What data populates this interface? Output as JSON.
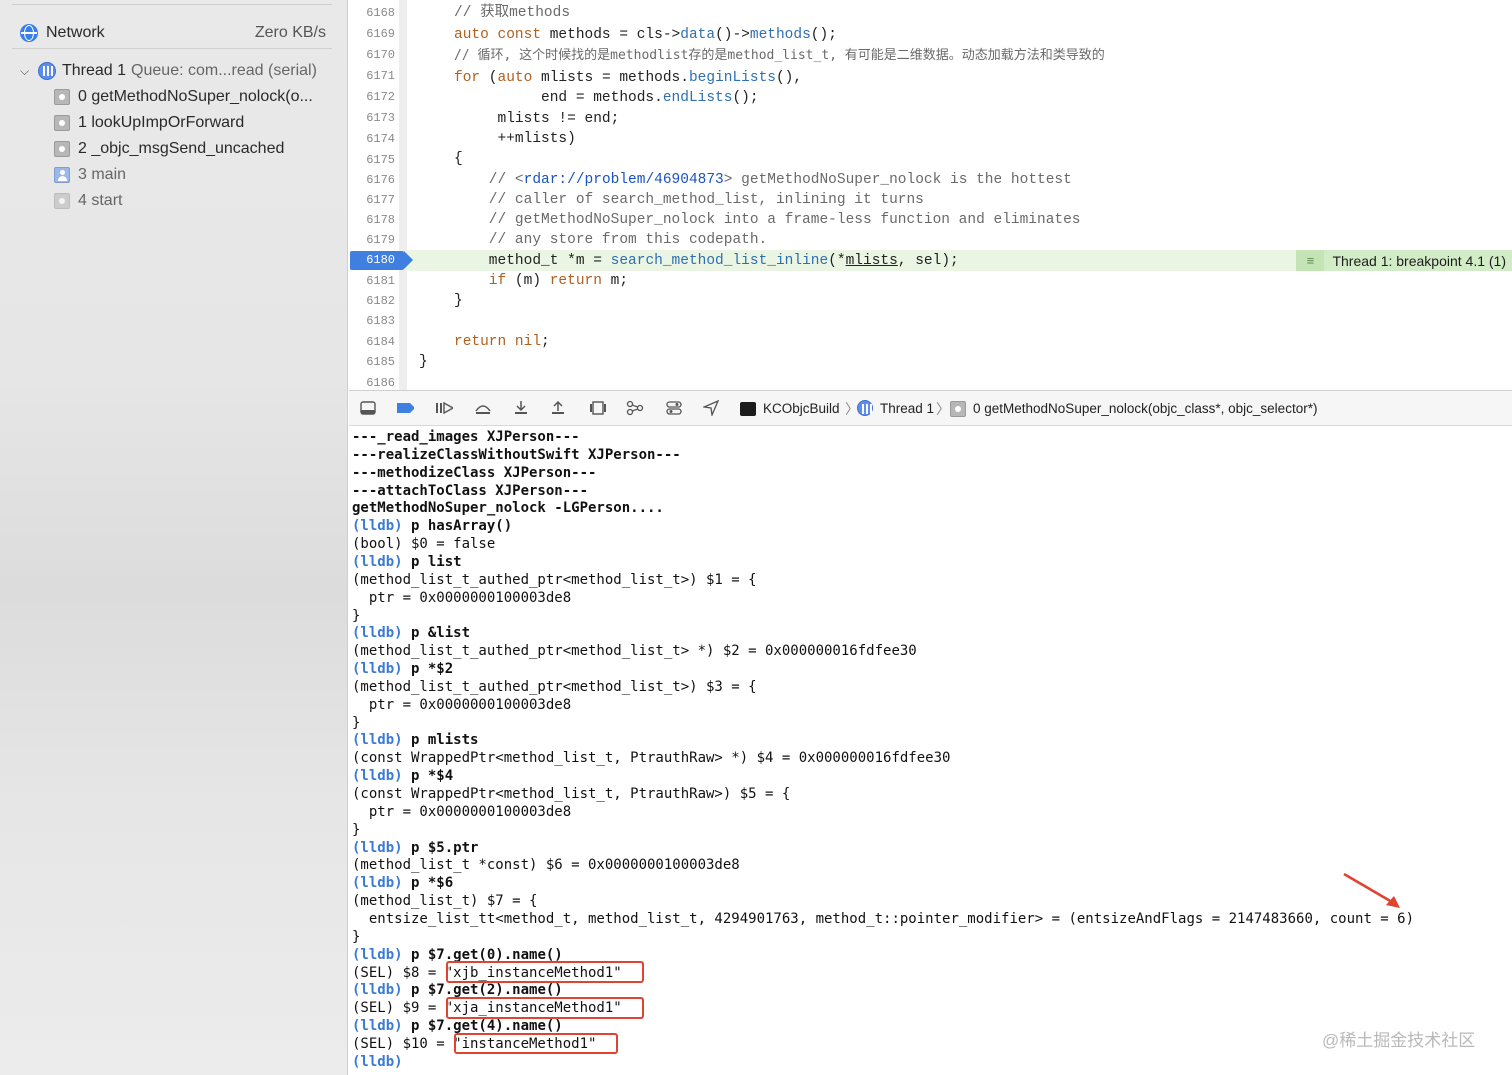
{
  "sidebar": {
    "network": {
      "label": "Network",
      "value": "Zero KB/s"
    },
    "thread": {
      "name": "Thread 1",
      "queue": "Queue: com...read (serial)"
    },
    "frames": [
      {
        "label": "0 getMethodNoSuper_nolock(o..."
      },
      {
        "label": "1 lookUpImpOrForward"
      },
      {
        "label": "2 _objc_msgSend_uncached"
      },
      {
        "label": "3 main"
      },
      {
        "label": "4 start"
      }
    ]
  },
  "editor": {
    "line_numbers": [
      "6168",
      "6169",
      "6170",
      "6171",
      "6172",
      "6173",
      "6174",
      "6175",
      "6176",
      "6177",
      "6178",
      "6179",
      "6180",
      "6181",
      "6182",
      "6183",
      "6184",
      "6185",
      "6186"
    ],
    "current_line": "6180",
    "breakpoint_label": "Thread 1: breakpoint 4.1 (1)",
    "code": {
      "l6168": "// 获取methods",
      "l6169_kw1": "auto const",
      "l6169_a": " methods = cls->",
      "l6169_fn1": "data",
      "l6169_b": "()->",
      "l6169_fn2": "methods",
      "l6169_c": "();",
      "l6170": "// 循环, 这个时候找的是methodlist存的是method_list_t, 有可能是二维数据。动态加载方法和类导致的",
      "l6171_kw1": "for",
      "l6171_a": " (",
      "l6171_kw2": "auto",
      "l6171_b": " mlists = methods.",
      "l6171_fn": "beginLists",
      "l6171_c": "(),",
      "l6172_a": "          end = methods.",
      "l6172_fn": "endLists",
      "l6172_b": "();",
      "l6173": "     mlists != end;",
      "l6174": "     ++mlists)",
      "l6175": "{",
      "l6176_a": "    // <",
      "l6176_link": "rdar://problem/46904873",
      "l6176_b": "> getMethodNoSuper_nolock is the hottest",
      "l6177": "    // caller of search_method_list, inlining it turns",
      "l6178": "    // getMethodNoSuper_nolock into a frame-less function and eliminates",
      "l6179": "    // any store from this codepath.",
      "l6180_a": "    method_t *m = ",
      "l6180_fn": "search_method_list_inline",
      "l6180_b": "(*",
      "l6180_sq": "mlists",
      "l6180_c": ", sel);",
      "l6181_kw1": "    if",
      "l6181_a": " (m) ",
      "l6181_kw2": "return",
      "l6181_b": " m;",
      "l6182": "}",
      "l6184_kw": "return nil",
      "l6184_a": ";",
      "l6185": "}"
    }
  },
  "debugbar": {
    "crumbs": [
      "KCObjcBuild",
      "Thread 1",
      "0 getMethodNoSuper_nolock(objc_class*, objc_selector*)"
    ]
  },
  "console": {
    "lines": [
      {
        "t": "---_read_images XJPerson---",
        "bold": true
      },
      {
        "t": "---realizeClassWithoutSwift XJPerson---",
        "bold": true
      },
      {
        "t": "---methodizeClass XJPerson---",
        "bold": true
      },
      {
        "t": "---attachToClass XJPerson---",
        "bold": true
      },
      {
        "t": "getMethodNoSuper_nolock -LGPerson....",
        "bold": true
      },
      {
        "p": "(lldb)",
        "t": " p hasArray()"
      },
      {
        "t": "(bool) $0 = false"
      },
      {
        "p": "(lldb)",
        "t": " p list"
      },
      {
        "t": "(method_list_t_authed_ptr<method_list_t>) $1 = {"
      },
      {
        "t": "  ptr = 0x0000000100003de8"
      },
      {
        "t": "}"
      },
      {
        "p": "(lldb)",
        "t": " p &list"
      },
      {
        "t": "(method_list_t_authed_ptr<method_list_t> *) $2 = 0x000000016fdfee30"
      },
      {
        "p": "(lldb)",
        "t": " p *$2"
      },
      {
        "t": "(method_list_t_authed_ptr<method_list_t>) $3 = {"
      },
      {
        "t": "  ptr = 0x0000000100003de8"
      },
      {
        "t": "}"
      },
      {
        "p": "(lldb)",
        "t": " p mlists"
      },
      {
        "t": "(const WrappedPtr<method_list_t, PtrauthRaw> *) $4 = 0x000000016fdfee30"
      },
      {
        "p": "(lldb)",
        "t": " p *$4"
      },
      {
        "t": "(const WrappedPtr<method_list_t, PtrauthRaw>) $5 = {"
      },
      {
        "t": "  ptr = 0x0000000100003de8"
      },
      {
        "t": "}"
      },
      {
        "p": "(lldb)",
        "t": " p $5.ptr"
      },
      {
        "t": "(method_list_t *const) $6 = 0x0000000100003de8"
      },
      {
        "p": "(lldb)",
        "t": " p *$6"
      },
      {
        "t": "(method_list_t) $7 = {"
      },
      {
        "t": "  entsize_list_tt<method_t, method_list_t, 4294901763, method_t::pointer_modifier> = (entsizeAndFlags = 2147483660, count = 6)"
      },
      {
        "t": "}"
      },
      {
        "p": "(lldb)",
        "t": " p $7.get(0).name()"
      },
      {
        "t": "(SEL) $8 = \"xjb_instanceMethod1\""
      },
      {
        "p": "(lldb)",
        "t": " p $7.get(2).name()"
      },
      {
        "t": "(SEL) $9 = \"xja_instanceMethod1\""
      },
      {
        "p": "(lldb)",
        "t": " p $7.get(4).name()"
      },
      {
        "t": "(SEL) $10 = \"instanceMethod1\""
      },
      {
        "p": "(lldb)",
        "t": ""
      }
    ]
  },
  "watermark": "@稀土掘金技术社区",
  "colors": {
    "accent": "#3f7fe0",
    "annotation": "#e0432f",
    "breakpoint_bg": "#d3ecc8"
  }
}
